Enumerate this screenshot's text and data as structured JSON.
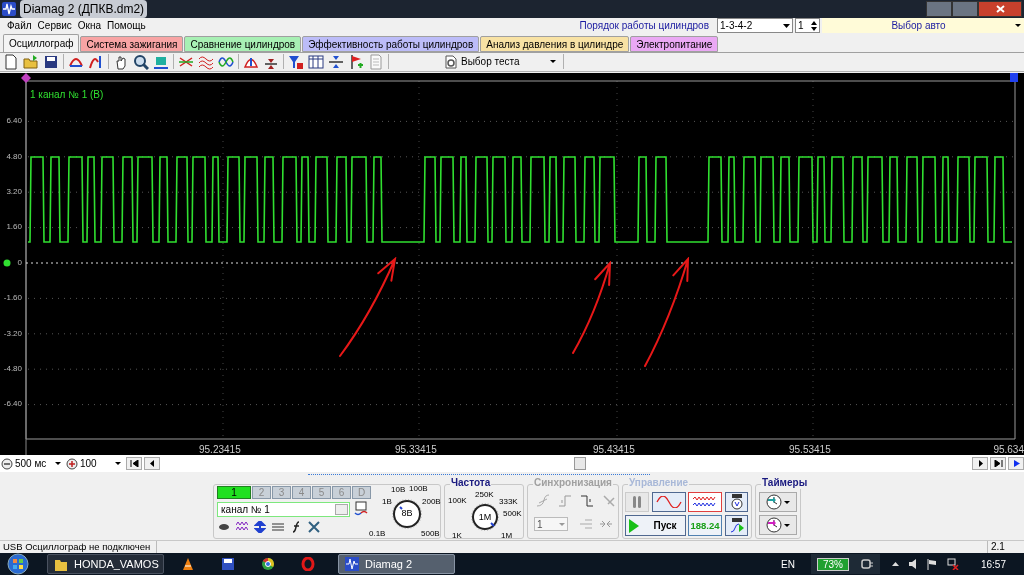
{
  "window": {
    "title": "Diamag 2 (ДПКВ.dm2)"
  },
  "menu": [
    "Файл",
    "Сервис",
    "Окна",
    "Помощь"
  ],
  "cylinder_order": {
    "label": "Порядок работы цилиндров",
    "value": "1-3-4-2",
    "spin_value": "1"
  },
  "car_select": {
    "value": "Выбор авто"
  },
  "tabs": [
    {
      "label": "Осциллограф",
      "selected": true,
      "color": "#f4f4f4"
    },
    {
      "label": "Система зажигания",
      "selected": false,
      "color": "#f8a4a4"
    },
    {
      "label": "Сравнение цилиндров",
      "selected": false,
      "color": "#a8f0b4"
    },
    {
      "label": "Эффективность работы цилиндров",
      "selected": false,
      "color": "#bcbcf8"
    },
    {
      "label": "Анализ давления в цилиндре",
      "selected": false,
      "color": "#f8e2a4"
    },
    {
      "label": "Электропитание",
      "selected": false,
      "color": "#eaa8f4"
    }
  ],
  "toolbar": {
    "test_select": "Выбор теста"
  },
  "plot": {
    "trace_label": "1  канал № 1 (В)",
    "y_ticks": [
      "6.40",
      "4.80",
      "3.20",
      "1.60",
      "0",
      "-1.60",
      "-3.20",
      "-4.80",
      "-6.40"
    ],
    "x_ticks": [
      "95.23415",
      "95.33415",
      "95.43415",
      "95.53415",
      "95.634"
    ]
  },
  "timebase": {
    "value": "500 мс"
  },
  "zoom": {
    "value": "100"
  },
  "channel_panel": {
    "channels": [
      {
        "label": "1",
        "selected": true
      },
      {
        "label": "2",
        "selected": false
      },
      {
        "label": "3",
        "selected": false
      },
      {
        "label": "4",
        "selected": false
      },
      {
        "label": "5",
        "selected": false
      },
      {
        "label": "6",
        "selected": false
      },
      {
        "label": "D",
        "selected": false
      }
    ],
    "name": "канал № 1"
  },
  "volt_knob": {
    "labels": [
      "10В",
      "100В",
      "1В",
      "200В",
      "0.1В",
      "500В"
    ],
    "value": "8В"
  },
  "frequency": {
    "title": "Частота",
    "labels": [
      "250K",
      "100K",
      "333K",
      "500K",
      "1K",
      "1M"
    ],
    "value": "1M"
  },
  "sync": {
    "title": "Синхронизация",
    "channel": "1"
  },
  "control": {
    "title": "Управление",
    "start": "Пуск",
    "reading": "188.24"
  },
  "timers": {
    "title": "Таймеры"
  },
  "status_bar": {
    "message": "USB Осциллограф не подключен",
    "version": "2.1"
  },
  "taskbar": {
    "buttons": [
      {
        "kind": "folder",
        "label": "HONDA_VAMOS",
        "selected": false
      },
      {
        "kind": "cone"
      },
      {
        "kind": "floppy"
      },
      {
        "kind": "chrome"
      },
      {
        "kind": "opera"
      },
      {
        "kind": "app",
        "label": "Diamag 2",
        "selected": true
      }
    ],
    "language": "EN",
    "battery": "73%",
    "clock": "16:57"
  }
}
